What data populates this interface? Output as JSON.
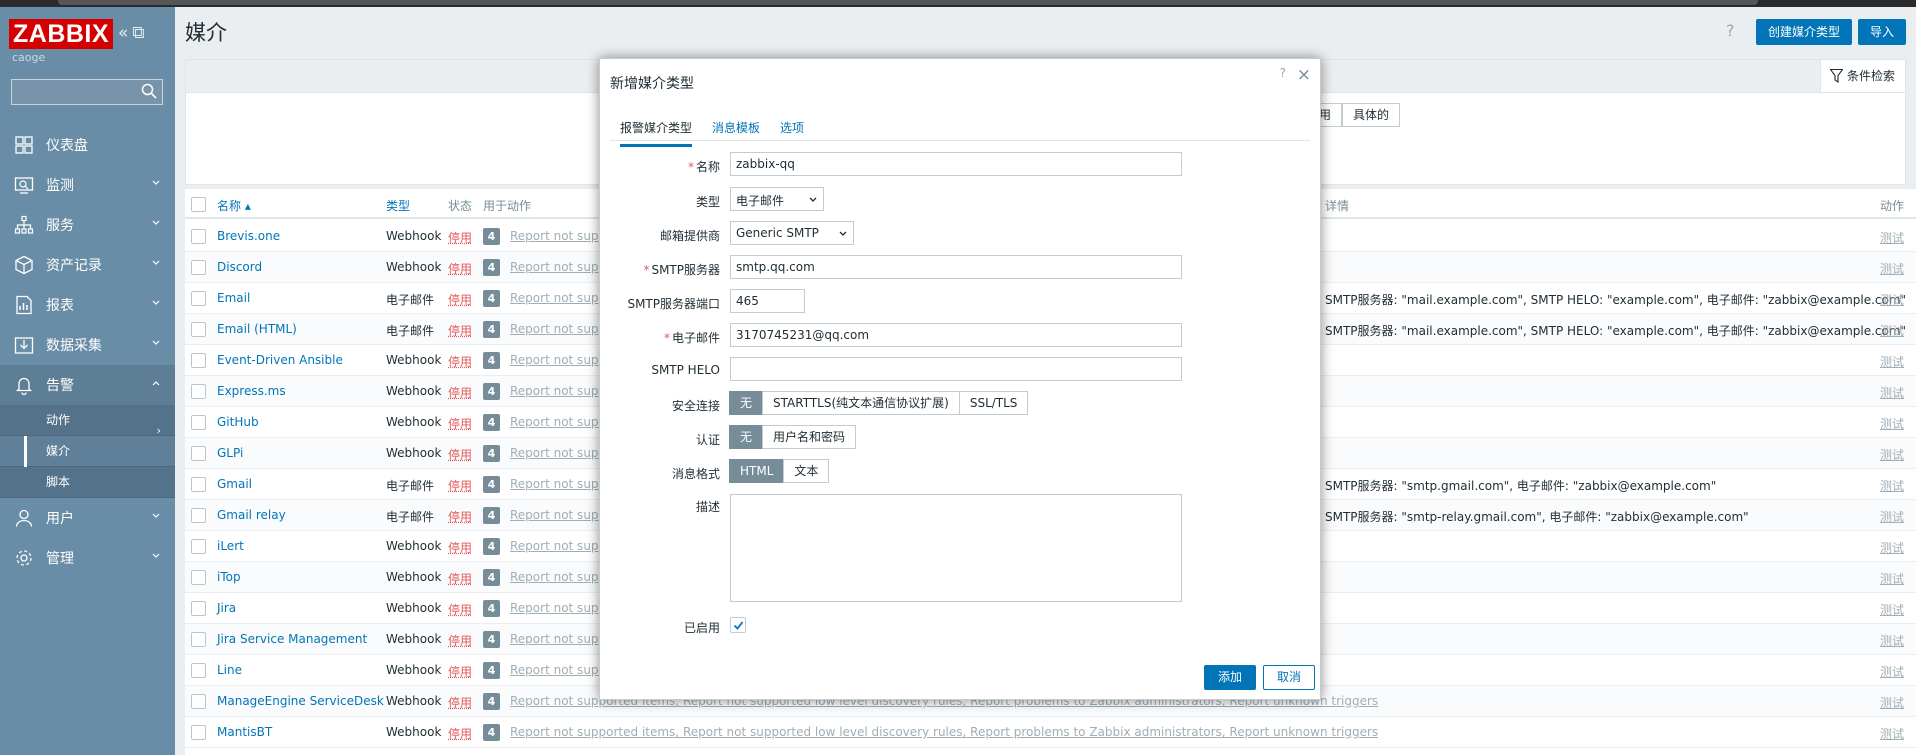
{
  "sidebar": {
    "logo": "ZABBIX",
    "user": "caoge",
    "search_placeholder": "",
    "items": [
      {
        "label": "仪表盘",
        "icon": "dashboard-icon"
      },
      {
        "label": "监测",
        "icon": "monitoring-icon"
      },
      {
        "label": "服务",
        "icon": "services-icon"
      },
      {
        "label": "资产记录",
        "icon": "inventory-icon"
      },
      {
        "label": "报表",
        "icon": "reports-icon"
      },
      {
        "label": "数据采集",
        "icon": "data-collection-icon"
      },
      {
        "label": "告警",
        "icon": "bell-icon"
      },
      {
        "label": "用户",
        "icon": "user-icon"
      },
      {
        "label": "管理",
        "icon": "gear-icon"
      }
    ],
    "alerts_sub": [
      {
        "label": "动作"
      },
      {
        "label": "媒介"
      },
      {
        "label": "脚本"
      }
    ]
  },
  "header": {
    "title": "媒介",
    "help": "?",
    "create_button": "创建媒介类型",
    "import_button": "导入"
  },
  "filter": {
    "tab_label": "条件检索",
    "seg_partial": "用",
    "seg_specific": "具体的"
  },
  "table": {
    "headers": {
      "name": "名称 ▴",
      "type": "类型",
      "status": "状态",
      "used_in_actions": "用于动作",
      "details": "详情",
      "action": "动作"
    },
    "rows": [
      {
        "name": "Brevis.one",
        "type": "Webhook",
        "status": "停用",
        "count": "4",
        "actions": "Report not suppor",
        "details": ""
      },
      {
        "name": "Discord",
        "type": "Webhook",
        "status": "停用",
        "count": "4",
        "actions": "Report not suppor",
        "details": ""
      },
      {
        "name": "Email",
        "type": "电子邮件",
        "status": "停用",
        "count": "4",
        "actions": "Report not suppor",
        "details": "SMTP服务器: \"mail.example.com\", SMTP HELO: \"example.com\", 电子邮件: \"zabbix@example.com\""
      },
      {
        "name": "Email (HTML)",
        "type": "电子邮件",
        "status": "停用",
        "count": "4",
        "actions": "Report not suppor",
        "details": "SMTP服务器: \"mail.example.com\", SMTP HELO: \"example.com\", 电子邮件: \"zabbix@example.com\""
      },
      {
        "name": "Event-Driven Ansible",
        "type": "Webhook",
        "status": "停用",
        "count": "4",
        "actions": "Report not suppor",
        "details": ""
      },
      {
        "name": "Express.ms",
        "type": "Webhook",
        "status": "停用",
        "count": "4",
        "actions": "Report not suppor",
        "details": ""
      },
      {
        "name": "GitHub",
        "type": "Webhook",
        "status": "停用",
        "count": "4",
        "actions": "Report not suppor",
        "details": ""
      },
      {
        "name": "GLPi",
        "type": "Webhook",
        "status": "停用",
        "count": "4",
        "actions": "Report not suppor",
        "details": ""
      },
      {
        "name": "Gmail",
        "type": "电子邮件",
        "status": "停用",
        "count": "4",
        "actions": "Report not suppor",
        "details": "SMTP服务器: \"smtp.gmail.com\", 电子邮件: \"zabbix@example.com\""
      },
      {
        "name": "Gmail relay",
        "type": "电子邮件",
        "status": "停用",
        "count": "4",
        "actions": "Report not suppor",
        "details": "SMTP服务器: \"smtp-relay.gmail.com\", 电子邮件: \"zabbix@example.com\""
      },
      {
        "name": "iLert",
        "type": "Webhook",
        "status": "停用",
        "count": "4",
        "actions": "Report not suppor",
        "details": ""
      },
      {
        "name": "iTop",
        "type": "Webhook",
        "status": "停用",
        "count": "4",
        "actions": "Report not suppor",
        "details": ""
      },
      {
        "name": "Jira",
        "type": "Webhook",
        "status": "停用",
        "count": "4",
        "actions": "Report not suppor",
        "details": ""
      },
      {
        "name": "Jira Service Management",
        "type": "Webhook",
        "status": "停用",
        "count": "4",
        "actions": "Report not suppor",
        "details": ""
      },
      {
        "name": "Line",
        "type": "Webhook",
        "status": "停用",
        "count": "4",
        "actions": "Report not suppor",
        "details": ""
      },
      {
        "name": "ManageEngine ServiceDesk",
        "type": "Webhook",
        "status": "停用",
        "count": "4",
        "actions": "Report not supported items, Report not supported low level discovery rules, Report problems to Zabbix administrators, Report unknown triggers",
        "details": ""
      },
      {
        "name": "MantisBT",
        "type": "Webhook",
        "status": "停用",
        "count": "4",
        "actions": "Report not supported items, Report not supported low level discovery rules, Report problems to Zabbix administrators, Report unknown triggers",
        "details": ""
      }
    ],
    "test_label": "测试"
  },
  "modal": {
    "title": "新增媒介类型",
    "help": "?",
    "close": "×",
    "tabs": [
      {
        "label": "报警媒介类型"
      },
      {
        "label": "消息模板"
      },
      {
        "label": "选项"
      }
    ],
    "fields": {
      "name_label": "名称",
      "name_value": "zabbix-qq",
      "type_label": "类型",
      "type_value": "电子邮件",
      "provider_label": "邮箱提供商",
      "provider_value": "Generic SMTP",
      "smtp_server_label": "SMTP服务器",
      "smtp_server_value": "smtp.qq.com",
      "smtp_port_label": "SMTP服务器端口",
      "smtp_port_value": "465",
      "email_label": "电子邮件",
      "email_value": "3170745231@qq.com",
      "helo_label": "SMTP HELO",
      "helo_value": "",
      "security_label": "安全连接",
      "security_options": [
        "无",
        "STARTTLS(纯文本通信协议扩展)",
        "SSL/TLS"
      ],
      "auth_label": "认证",
      "auth_options": [
        "无",
        "用户名和密码"
      ],
      "format_label": "消息格式",
      "format_options": [
        "HTML",
        "文本"
      ],
      "desc_label": "描述",
      "enabled_label": "已启用"
    },
    "add_button": "添加",
    "cancel_button": "取消"
  }
}
